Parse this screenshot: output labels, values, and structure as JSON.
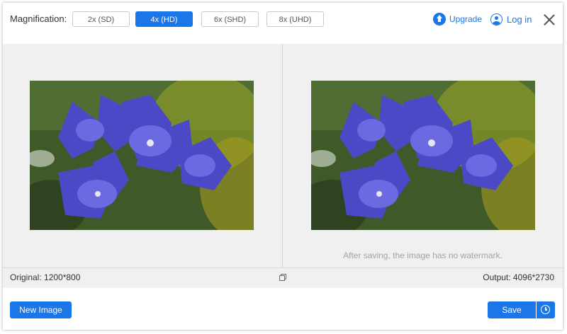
{
  "header": {
    "magnification_label": "Magnification:",
    "options": [
      "2x (SD)",
      "4x (HD)",
      "6x (SHD)",
      "8x (UHD)"
    ],
    "selected_option": "4x (HD)",
    "upgrade_label": "Upgrade",
    "login_label": "Log in"
  },
  "preview": {
    "watermark_note": "After saving, the image has no watermark."
  },
  "info": {
    "original": "Original: 1200*800",
    "output": "Output: 4096*2730"
  },
  "footer": {
    "new_image_label": "New Image",
    "save_label": "Save"
  },
  "colors": {
    "accent": "#1b76e8",
    "preview_bg": "#f0f0f0"
  },
  "icons": {
    "upgrade": "upgrade-arrow-icon",
    "login": "user-icon",
    "close": "close-icon",
    "compare": "compare-icon",
    "history": "clock-icon"
  }
}
